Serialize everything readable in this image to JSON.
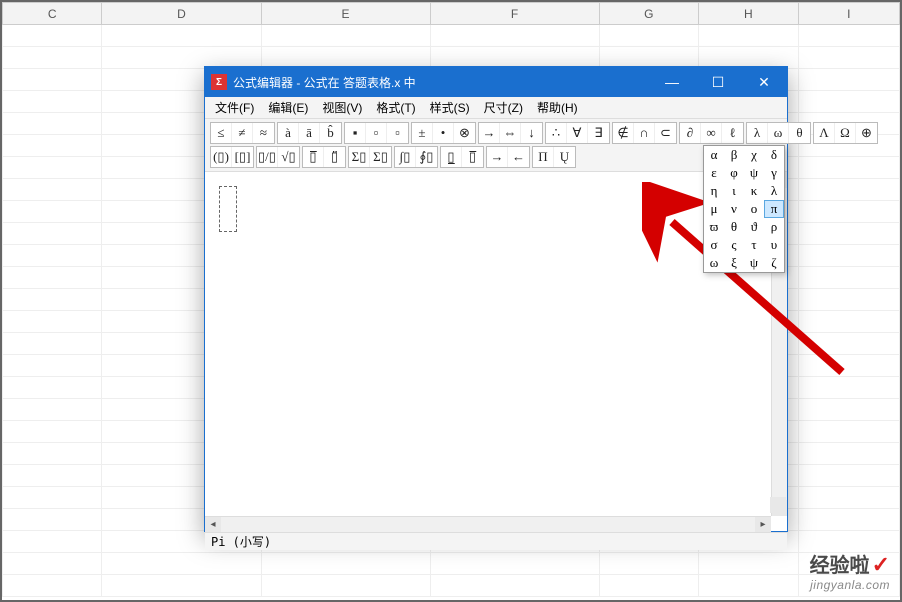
{
  "spreadsheet": {
    "columns": [
      "C",
      "D",
      "E",
      "F",
      "G",
      "H",
      "I"
    ]
  },
  "window": {
    "app_icon_text": "Σ",
    "title": "公式编辑器 - 公式在 答题表格.x 中",
    "min": "—",
    "max": "☐",
    "close": "✕"
  },
  "menus": {
    "file": "文件(F)",
    "edit": "编辑(E)",
    "view": "视图(V)",
    "format": "格式(T)",
    "style": "样式(S)",
    "size": "尺寸(Z)",
    "help": "帮助(H)"
  },
  "toolbar_row1": {
    "g1": [
      "≤",
      "≠",
      "≈"
    ],
    "g2": [
      "à",
      "ā",
      "b̂"
    ],
    "g3": [
      "▪",
      "▫",
      "▫"
    ],
    "g4": [
      "±",
      "•",
      "⊗"
    ],
    "g5": [
      "→",
      "⇔",
      "↓"
    ],
    "g6": [
      "∴",
      "∀",
      "∃"
    ],
    "g7": [
      "∉",
      "∩",
      "⊂"
    ],
    "g8": [
      "∂",
      "∞",
      "ℓ"
    ],
    "g9": [
      "λ",
      "ω",
      "θ"
    ],
    "g10": [
      "Λ",
      "Ω",
      "⊕"
    ]
  },
  "toolbar_row2": {
    "g1": [
      "(▯)",
      "[▯]"
    ],
    "g2": [
      "▯/▯",
      "√▯"
    ],
    "g3": [
      "▯̅",
      "▯̈"
    ],
    "g4": [
      "Σ▯",
      "Σ▯"
    ],
    "g5": [
      "∫▯",
      "∮▯"
    ],
    "g6": [
      "▯̲",
      "▯̅"
    ],
    "g7": [
      "→",
      "←"
    ],
    "g8": [
      "Π",
      "Ų"
    ],
    "g9_greek": [
      [
        "α",
        "β",
        "χ",
        "δ"
      ],
      [
        "ε",
        "φ",
        "ψ",
        "γ"
      ],
      [
        "η",
        "ι",
        "κ",
        "λ"
      ],
      [
        "μ",
        "ν",
        "ο",
        "π"
      ],
      [
        "ϖ",
        "θ",
        "ϑ",
        "ρ"
      ],
      [
        "σ",
        "ς",
        "τ",
        "υ"
      ],
      [
        "ω",
        "ξ",
        "ψ",
        "ζ"
      ]
    ]
  },
  "greek_hover_index": [
    3,
    3
  ],
  "status": "Pi (小写)",
  "scroll": {
    "up": "▴",
    "down": "▾",
    "left": "◂",
    "right": "▸"
  },
  "watermark": {
    "line1": "经验啦",
    "check": "✓",
    "line2": "jingyanla.com"
  }
}
